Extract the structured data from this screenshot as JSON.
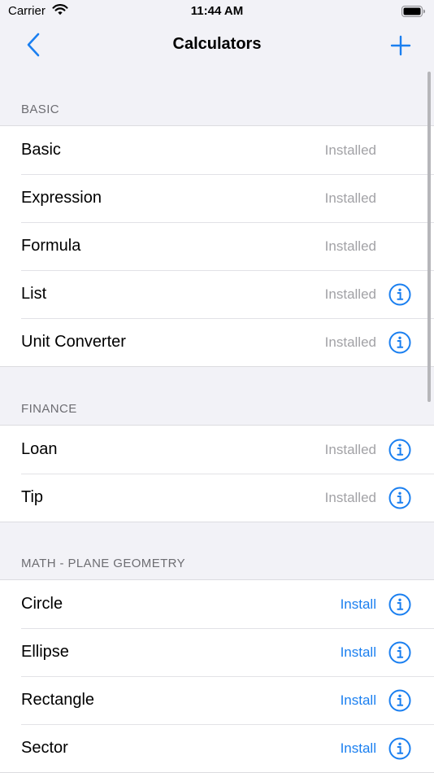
{
  "status_bar": {
    "carrier": "Carrier",
    "time": "11:44 AM"
  },
  "nav": {
    "title": "Calculators",
    "back_icon": "chevron-left-icon",
    "add_icon": "plus-icon"
  },
  "colors": {
    "accent": "#1a7ff0",
    "installed_text": "#a2a2a6",
    "section_header": "#6d6d72",
    "background": "#f2f2f7"
  },
  "sections": [
    {
      "header": "BASIC",
      "rows": [
        {
          "label": "Basic",
          "status": "Installed",
          "info": false
        },
        {
          "label": "Expression",
          "status": "Installed",
          "info": false
        },
        {
          "label": "Formula",
          "status": "Installed",
          "info": false
        },
        {
          "label": "List",
          "status": "Installed",
          "info": true
        },
        {
          "label": "Unit Converter",
          "status": "Installed",
          "info": true
        }
      ]
    },
    {
      "header": "FINANCE",
      "rows": [
        {
          "label": "Loan",
          "status": "Installed",
          "info": true
        },
        {
          "label": "Tip",
          "status": "Installed",
          "info": true
        }
      ]
    },
    {
      "header": "MATH - PLANE GEOMETRY",
      "rows": [
        {
          "label": "Circle",
          "status": "Install",
          "info": true
        },
        {
          "label": "Ellipse",
          "status": "Install",
          "info": true
        },
        {
          "label": "Rectangle",
          "status": "Install",
          "info": true
        },
        {
          "label": "Sector",
          "status": "Install",
          "info": true
        }
      ]
    }
  ]
}
